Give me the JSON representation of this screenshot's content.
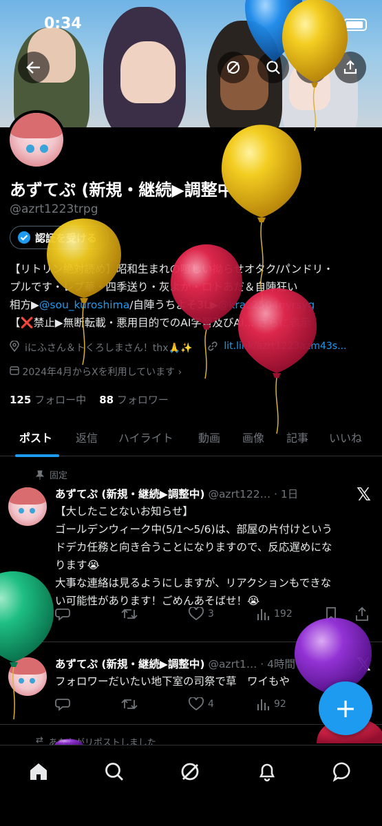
{
  "status_bar": {
    "time": "0:34"
  },
  "profile": {
    "name": "あずてぷ (新規・継続▶調整中)",
    "handle": "@azrt1223trpg",
    "verify_label": "認証を受ける",
    "bio_line1": "【リトリン絶対読め】昭和生まれの喧しい拗らせオタク/パンドリ・",
    "bio_line2": "プルです・レプ華・四季送り・灰よか・ロトあだ＆自陣狂い",
    "bio_line3_prefix": "相方▶",
    "bio_link1": "@sou_kuroshima",
    "bio_line3_mid": "/自陣うちよそ3L▶",
    "bio_link2": "@kraz2504nyrsyg",
    "bio_line4": "【❌禁止▶無断転載・悪用目的でのAI学習及びAI...",
    "bio_more": "さらに表示",
    "location": "iにふさん＆トくろしまさん！thx🙏✨",
    "website": "lit.link/azrt1223azm43s...",
    "joined": "2024年4月からXを利用しています",
    "following_count": "125",
    "following_label": "フォロー中",
    "followers_count": "88",
    "followers_label": "フォロワー"
  },
  "tabs": [
    "ポスト",
    "返信",
    "ハイライト",
    "動画",
    "画像",
    "記事",
    "いいね"
  ],
  "pinned_label": "固定",
  "posts": [
    {
      "name": "あずてぷ (新規・継続▶調整中)",
      "sub": "@azrt122… · 1日",
      "lines": [
        "【大したことないお知らせ】",
        "ゴールデンウィーク中(5/1〜5/6)は、部屋の片付けという",
        "ドデカ任務と向き合うことになりますので、反応遅めにな",
        "ります😭",
        "大事な連絡は見るようにしますが、リアクションもできな",
        "い可能性があります！ごめんあそばせ！😭"
      ],
      "likes": "3",
      "views": "192"
    },
    {
      "name": "あずてぷ (新規・継続▶調整中)",
      "sub": "@azrt1… · 4時間",
      "lines": [
        "フォロワーだいたい地下室の司祭で草　ワイもや"
      ],
      "likes": "4",
      "views": "92"
    }
  ],
  "repost_note": "あなたがリポストしました",
  "colors": {
    "accent": "#1d9bf0",
    "background": "#000000",
    "muted": "#71767b"
  },
  "icons": [
    "back-arrow-icon",
    "grok-icon",
    "search-icon",
    "edit-icon",
    "share-icon",
    "verified-badge-icon",
    "location-icon",
    "link-icon",
    "calendar-icon",
    "pin-icon",
    "x-logo-icon",
    "reply-icon",
    "repost-icon",
    "like-icon",
    "views-icon",
    "bookmark-icon",
    "plus-icon",
    "home-icon",
    "notifications-icon",
    "messages-icon"
  ]
}
